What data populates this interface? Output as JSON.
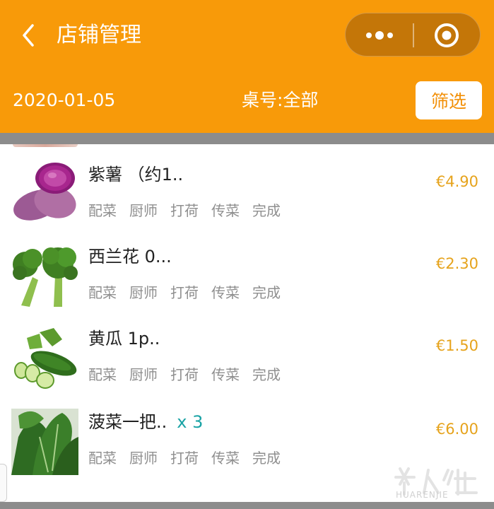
{
  "header": {
    "title": "店铺管理",
    "date": "2020-01-05",
    "table_label": "桌号:全部",
    "filter_label": "筛选",
    "colors": {
      "background": "#f89a09",
      "capsule": "#c47608"
    }
  },
  "items": [
    {
      "name": "紫薯 （约1..",
      "price": "€4.90",
      "qty": "",
      "thumb_icon": "purple-sweet-potato",
      "steps": [
        "配菜",
        "厨师",
        "打荷",
        "传菜",
        "完成"
      ]
    },
    {
      "name": "西兰花 0...",
      "price": "€2.30",
      "qty": "",
      "thumb_icon": "broccoli",
      "steps": [
        "配菜",
        "厨师",
        "打荷",
        "传菜",
        "完成"
      ]
    },
    {
      "name": "黄瓜 1p..",
      "price": "€1.50",
      "qty": "",
      "thumb_icon": "cucumber",
      "steps": [
        "配菜",
        "厨师",
        "打荷",
        "传菜",
        "完成"
      ]
    },
    {
      "name": "菠菜一把..",
      "price": "€6.00",
      "qty": "x 3",
      "thumb_icon": "spinach",
      "steps": [
        "配菜",
        "厨师",
        "打荷",
        "传菜",
        "完成"
      ]
    }
  ],
  "watermark": {
    "text": "HUARENJIE"
  },
  "colors": {
    "price": "#e6a31c",
    "qty": "#1aa3a5",
    "step": "#8f8f8f"
  }
}
